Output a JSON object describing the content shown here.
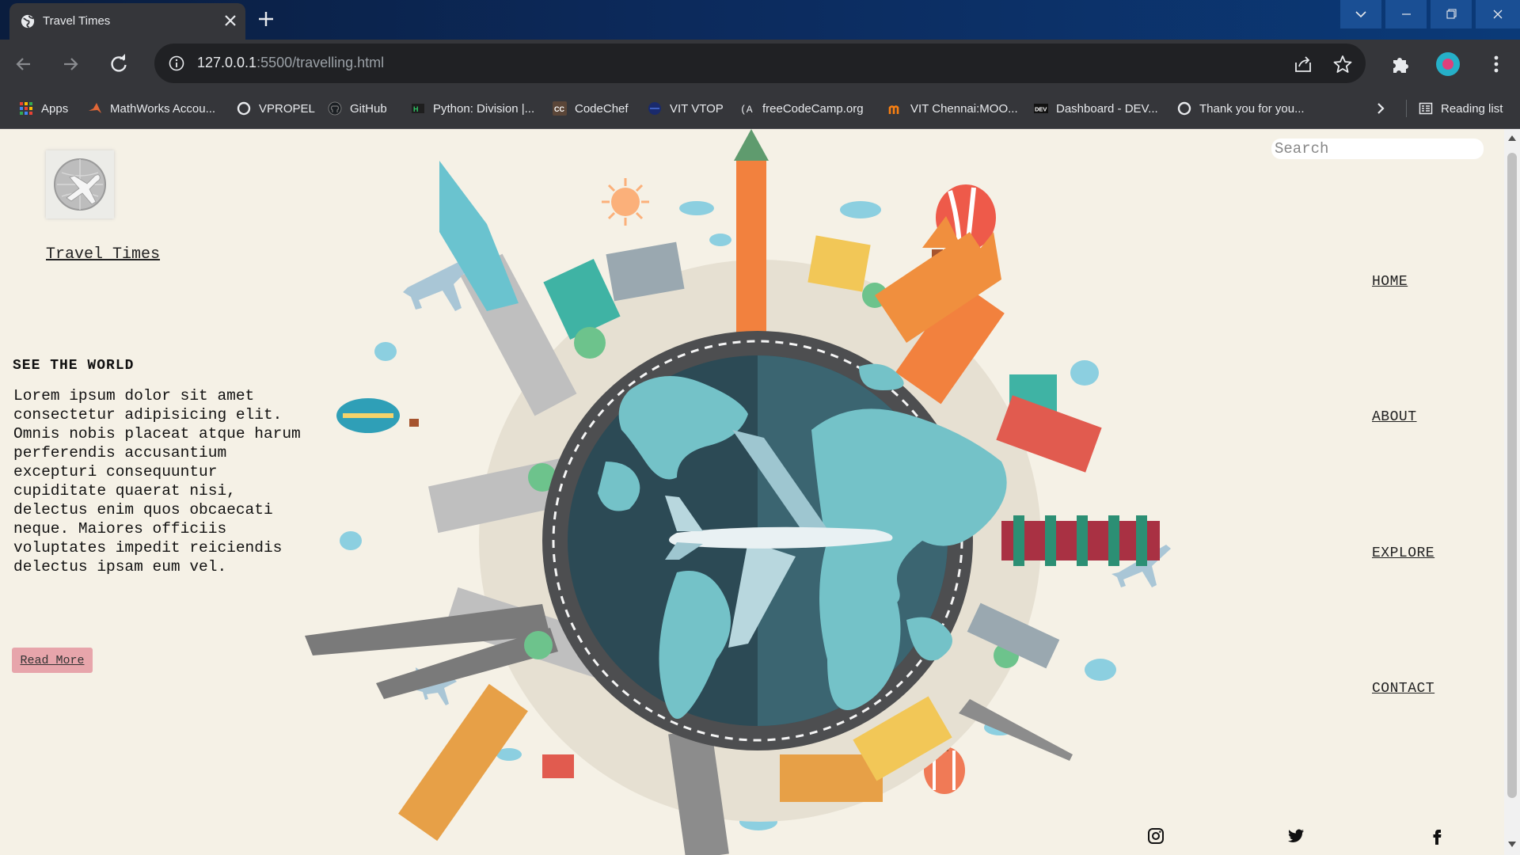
{
  "browser": {
    "tab_title": "Travel Times",
    "url_host": "127.0.0.1",
    "url_rest": ":5500/travelling.html",
    "bookmarks": [
      {
        "label": "Apps",
        "icon": "apps-grid-icon"
      },
      {
        "label": "MathWorks Accou...",
        "icon": "mathworks-icon"
      },
      {
        "label": "VPROPEL",
        "icon": "vpropel-icon"
      },
      {
        "label": "GitHub",
        "icon": "github-icon"
      },
      {
        "label": "Python: Division |...",
        "icon": "python-site-icon"
      },
      {
        "label": "CodeChef",
        "icon": "codechef-icon"
      },
      {
        "label": "VIT VTOP",
        "icon": "vtop-icon"
      },
      {
        "label": "freeCodeCamp.org",
        "icon": "freecodecamp-icon"
      },
      {
        "label": "VIT Chennai:MOO...",
        "icon": "moodle-icon"
      },
      {
        "label": "Dashboard - DEV...",
        "icon": "dev-icon"
      },
      {
        "label": "Thank you for you...",
        "icon": "thankyou-icon"
      }
    ],
    "reading_list": "Reading list"
  },
  "page": {
    "brand": "Travel Times",
    "hero_title": "SEE THE WORLD",
    "hero_text": "Lorem ipsum dolor sit amet consectetur adipisicing elit. Omnis nobis placeat atque harum perferendis accusantium excepturi consequuntur cupiditate quaerat nisi, delectus enim quos obcaecati neque. Maiores officiis voluptates impedit reiciendis delectus ipsam eum vel.",
    "read_more": "Read More",
    "search_placeholder": "Search",
    "nav": [
      "HOME",
      "ABOUT",
      "EXPLORE",
      "CONTACT"
    ],
    "social": [
      "instagram-icon",
      "twitter-icon",
      "facebook-icon"
    ]
  },
  "colors": {
    "page_bg": "#f5f1e6",
    "button_bg": "#e7a5ab",
    "ocean": "#2c4a55",
    "land": "#74c2c8",
    "ring": "#4d4e50"
  }
}
